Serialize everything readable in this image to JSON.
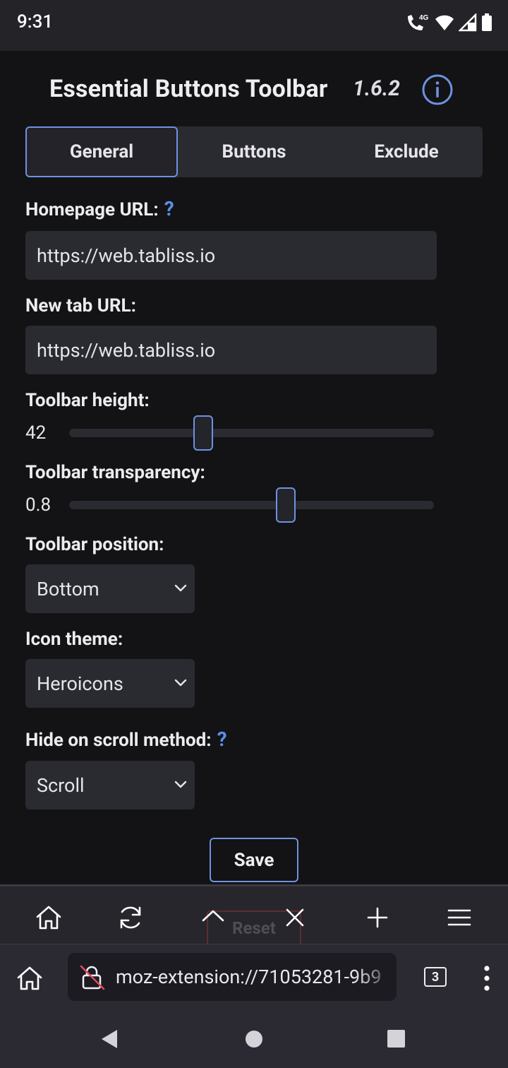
{
  "status_bar": {
    "time": "9:31",
    "network_label": "4G",
    "icons": [
      "wifi-calling-icon",
      "wifi-icon",
      "cell-signal-icon",
      "battery-icon"
    ]
  },
  "app": {
    "title": "Essential Buttons Toolbar",
    "version": "1.6.2",
    "info_icon": "info-icon"
  },
  "tabs": [
    {
      "label": "General",
      "active": true
    },
    {
      "label": "Buttons",
      "active": false
    },
    {
      "label": "Exclude",
      "active": false
    }
  ],
  "settings": {
    "homepage_url": {
      "label": "Homepage URL:",
      "help": "?",
      "value": "https://web.tabliss.io"
    },
    "new_tab_url": {
      "label": "New tab URL:",
      "value": "https://web.tabliss.io"
    },
    "toolbar_height": {
      "label": "Toolbar height:",
      "value": "42",
      "slider_fraction": 0.36
    },
    "toolbar_transparency": {
      "label": "Toolbar transparency:",
      "value": "0.8",
      "slider_fraction": 0.6
    },
    "toolbar_position": {
      "label": "Toolbar position:",
      "selected": "Bottom"
    },
    "icon_theme": {
      "label": "Icon theme:",
      "selected": "Heroicons"
    },
    "hide_on_scroll": {
      "label": "Hide on scroll method:",
      "help": "?",
      "selected": "Scroll"
    }
  },
  "actions": {
    "save_label": "Save",
    "reset_label": "Reset"
  },
  "ext_toolbar": {
    "buttons": [
      "home-icon",
      "reload-icon",
      "scroll-top-icon",
      "close-tab-icon",
      "new-tab-icon",
      "menu-icon"
    ]
  },
  "browser": {
    "url": "moz-extension://71053281-9b9",
    "tab_count": "3"
  },
  "colors": {
    "accent": "#6d92e0",
    "help": "#5a8ee8",
    "background": "#131315",
    "surface": "#2a2a31"
  }
}
